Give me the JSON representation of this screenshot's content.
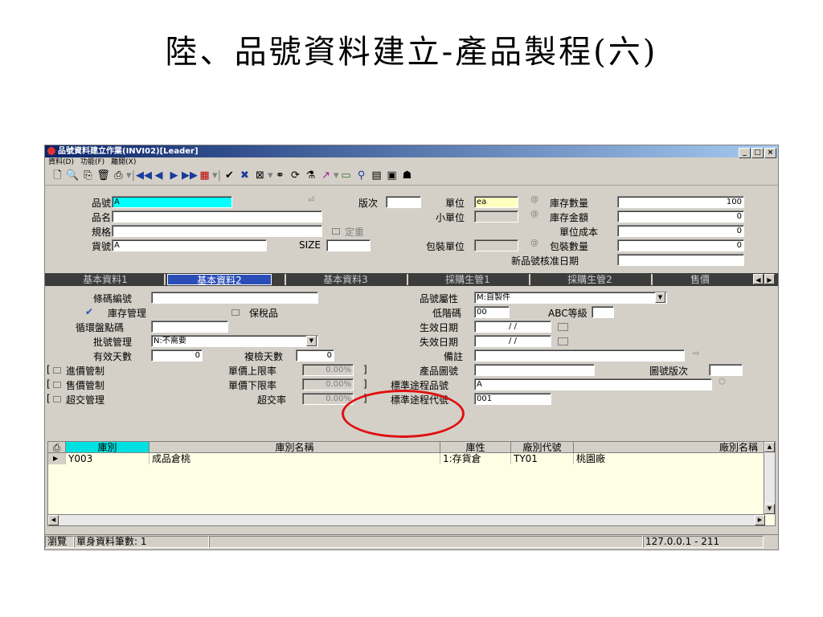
{
  "slide_title": "陸、品號資料建立-產品製程(六)",
  "window": {
    "title": "品號資料建立作業(INVI02)[Leader]",
    "menu": [
      "資料(D)",
      "功能(F)",
      "離開(X)"
    ],
    "min_label": "_",
    "max_label": "□",
    "close_label": "×"
  },
  "toolbar": {
    "icons": [
      "new-doc-icon",
      "preview-icon",
      "copy-icon",
      "delete-icon",
      "print-icon",
      "dropdown-icon",
      "first-record-icon",
      "prev-record-icon",
      "next-record-icon",
      "last-record-icon",
      "browse-icon",
      "dropdown-icon",
      "confirm-icon",
      "cancel-icon",
      "query-icon",
      "dropdown-icon",
      "link-icon",
      "refresh-icon",
      "filter-icon",
      "chart-icon",
      "dropdown-icon",
      "folder-icon",
      "attach-icon",
      "book-icon",
      "calc-icon",
      "user-icon"
    ]
  },
  "header": {
    "item_no_label": "品號",
    "item_no": "A",
    "version_label": "版次",
    "version": "",
    "unit_label": "單位",
    "unit": "ea",
    "stock_qty_label": "庫存數量",
    "stock_qty": "100",
    "item_name_label": "品名",
    "item_name": "",
    "small_unit_label": "小單位",
    "small_unit": "",
    "stock_amount_label": "庫存金額",
    "stock_amount": "0",
    "spec_label": "規格",
    "spec": "",
    "fixed_weight_label": "定重",
    "unit_cost_label": "單位成本",
    "unit_cost": "0",
    "cargo_no_label": "貨號",
    "cargo_no": "A",
    "size_label": "SIZE",
    "size": "",
    "pack_unit_label": "包裝單位",
    "pack_unit": "",
    "pack_qty_label": "包裝數量",
    "pack_qty": "0",
    "new_item_date_label": "新品號核准日期",
    "new_item_date": ""
  },
  "tabs": [
    "基本資料1",
    "基本資料2",
    "基本資料3",
    "採購生管1",
    "採購生管2",
    "售價"
  ],
  "active_tab": "基本資料2",
  "form": {
    "barcode_label": "條碼編號",
    "barcode": "",
    "stock_mgmt_label": "庫存管理",
    "bonded_label": "保稅品",
    "cycle_count_label": "循環盤點碼",
    "cycle_count": "",
    "batch_mgmt_label": "批號管理",
    "batch_mgmt": "N:不需要",
    "valid_days_label": "有效天數",
    "valid_days": "0",
    "recheck_days_label": "複檢天數",
    "recheck_days": "0",
    "purchase_price_ctrl_label": "進價管制",
    "sale_price_ctrl_label": "售價管制",
    "over_delivery_label": "超交管理",
    "upper_limit_label": "單價上限率",
    "upper_limit": "0.00%",
    "lower_limit_label": "單價下限率",
    "lower_limit": "0.00%",
    "over_rate_label": "超交率",
    "over_rate": "0.00%",
    "item_attr_label": "品號屬性",
    "item_attr": "M:自製件",
    "low_level_label": "低階碼",
    "low_level": "00",
    "abc_label": "ABC等級",
    "abc": "",
    "effective_date_label": "生效日期",
    "effective_date": "/ /",
    "expire_date_label": "失效日期",
    "expire_date": "/ /",
    "note_label": "備註",
    "note": "",
    "drawing_no_label": "產品圖號",
    "drawing_no": "",
    "drawing_ver_label": "圖號版次",
    "drawing_ver": "",
    "std_route_item_label": "標準途程品號",
    "std_route_item": "A",
    "std_route_code_label": "標準途程代號",
    "std_route_code": "001"
  },
  "grid": {
    "columns": [
      "庫別",
      "庫別名稱",
      "庫性",
      "廠別代號",
      "廠別名稱"
    ],
    "rows": [
      {
        "warehouse": "Y003",
        "warehouse_name": "成品倉桃",
        "type": "1:存貨倉",
        "factory_code": "TY01",
        "factory_name": "桃園廠"
      }
    ]
  },
  "status": {
    "mode": "瀏覽",
    "record_count": "單身資料筆數: 1",
    "ip": "127.0.0.1 - 211"
  }
}
